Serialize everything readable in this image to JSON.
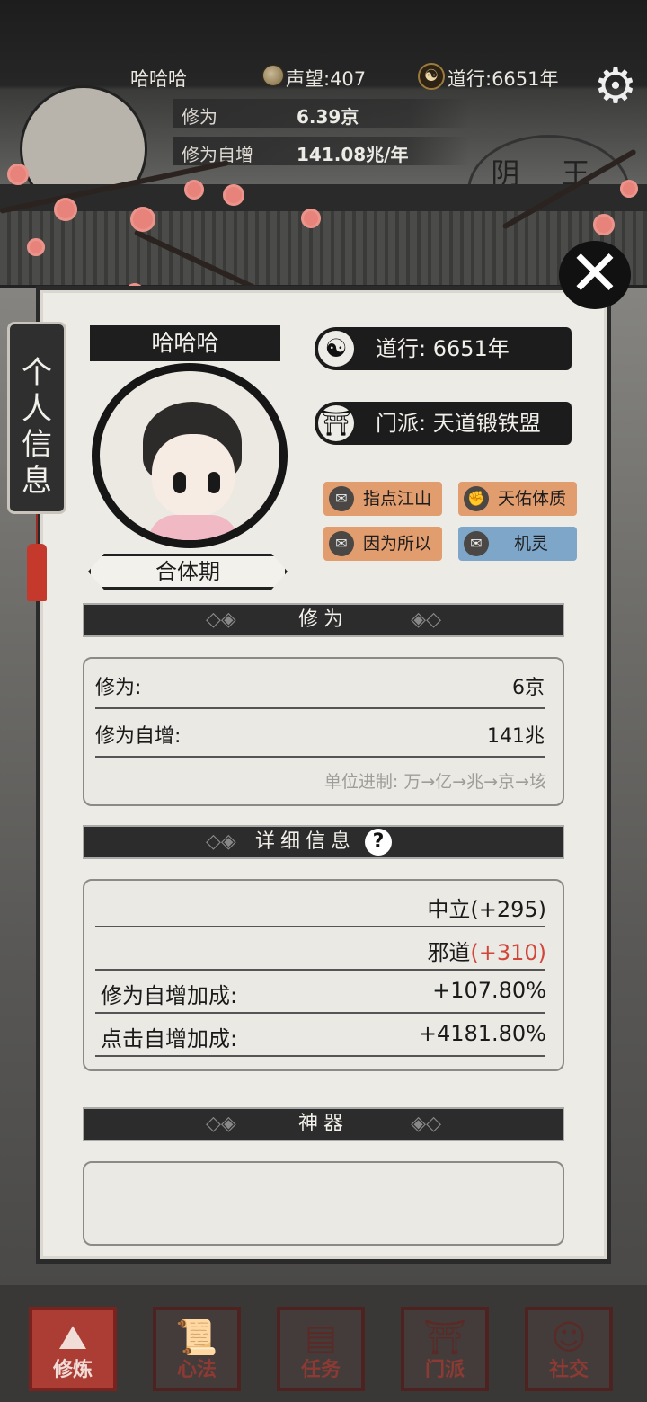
{
  "status_bar": {
    "player_name": "哈哈哈",
    "reputation_label": "声望:407",
    "daoxing_label": "道行:6651年"
  },
  "header_stats": [
    {
      "label": "修为",
      "value": "6.39京"
    },
    {
      "label": "修为自增",
      "value": "141.08兆/年"
    }
  ],
  "background_stamp": "阴 王",
  "side_tab": {
    "label_chars": [
      "个",
      "人",
      "信",
      "息"
    ]
  },
  "profile": {
    "name": "哈哈哈",
    "stage": "合体期",
    "daoxing": "道行: 6651年",
    "sect": "门派: 天道锻铁盟"
  },
  "traits": [
    {
      "label": "指点江山",
      "color": "#e29d6f",
      "icon": "scroll-icon"
    },
    {
      "label": "天佑体质",
      "color": "#e29d6f",
      "icon": "fist-icon"
    },
    {
      "label": "因为所以",
      "color": "#e29d6f",
      "icon": "scroll-icon"
    },
    {
      "label": "机灵",
      "color": "#7ea6c9",
      "icon": "scroll-icon"
    }
  ],
  "cultivation": {
    "title": "修为",
    "rows": [
      {
        "label": "修为:",
        "value": "6京"
      },
      {
        "label": "修为自增:",
        "value": "141兆"
      }
    ],
    "hint": "单位进制: 万→亿→兆→京→垓"
  },
  "details": {
    "title": "详细信息",
    "alignment_neutral": "中立(+295)",
    "alignment_evil_name": "邪道",
    "alignment_evil_value": "(+310)",
    "rows": [
      {
        "label": "修为自增加成:",
        "value": "+107.80%"
      },
      {
        "label": "点击自增加成:",
        "value": "+4181.80%"
      }
    ]
  },
  "artifacts": {
    "title": "神器"
  },
  "bottom_nav": [
    {
      "label": "修炼",
      "glyph": "⛰",
      "active": true
    },
    {
      "label": "心法",
      "glyph": "📜",
      "active": false
    },
    {
      "label": "任务",
      "glyph": "▤",
      "active": false
    },
    {
      "label": "门派",
      "glyph": "⛩",
      "active": false
    },
    {
      "label": "社交",
      "glyph": "☺",
      "active": false
    }
  ],
  "colors": {
    "accent_red": "#d2453a",
    "trait_orange": "#e29d6f",
    "trait_blue": "#7ea6c9",
    "nav_active": "#ab3d35"
  }
}
